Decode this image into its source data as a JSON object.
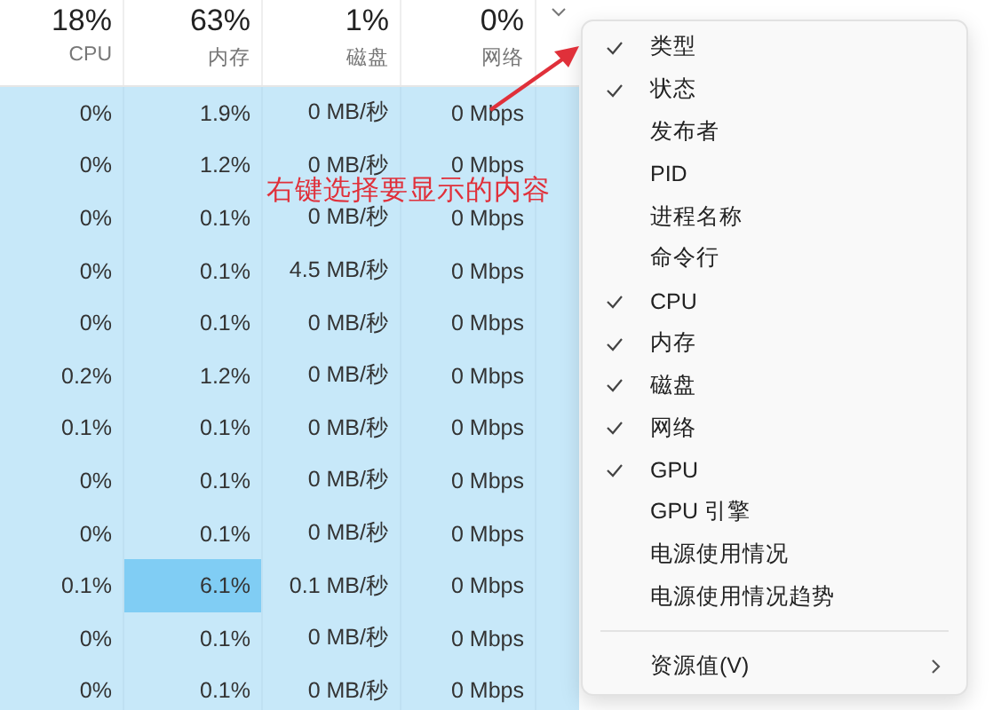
{
  "header": [
    {
      "value": "18%",
      "label": "CPU"
    },
    {
      "value": "63%",
      "label": "内存"
    },
    {
      "value": "1%",
      "label": "磁盘"
    },
    {
      "value": "0%",
      "label": "网络"
    }
  ],
  "rows": [
    {
      "cells": [
        "0%",
        "1.9%",
        "0 MB/秒",
        "0 Mbps"
      ],
      "memory_high": false
    },
    {
      "cells": [
        "0%",
        "1.2%",
        "0 MB/秒",
        "0 Mbps"
      ],
      "memory_high": false
    },
    {
      "cells": [
        "0%",
        "0.1%",
        "0 MB/秒",
        "0 Mbps"
      ],
      "memory_high": false
    },
    {
      "cells": [
        "0%",
        "0.1%",
        "4.5 MB/秒",
        "0 Mbps"
      ],
      "memory_high": false
    },
    {
      "cells": [
        "0%",
        "0.1%",
        "0 MB/秒",
        "0 Mbps"
      ],
      "memory_high": false
    },
    {
      "cells": [
        "0.2%",
        "1.2%",
        "0 MB/秒",
        "0 Mbps"
      ],
      "memory_high": false
    },
    {
      "cells": [
        "0.1%",
        "0.1%",
        "0 MB/秒",
        "0 Mbps"
      ],
      "memory_high": false
    },
    {
      "cells": [
        "0%",
        "0.1%",
        "0 MB/秒",
        "0 Mbps"
      ],
      "memory_high": false
    },
    {
      "cells": [
        "0%",
        "0.1%",
        "0 MB/秒",
        "0 Mbps"
      ],
      "memory_high": false
    },
    {
      "cells": [
        "0.1%",
        "6.1%",
        "0.1 MB/秒",
        "0 Mbps"
      ],
      "memory_high": true
    },
    {
      "cells": [
        "0%",
        "0.1%",
        "0 MB/秒",
        "0 Mbps"
      ],
      "memory_high": false
    },
    {
      "cells": [
        "0%",
        "0.1%",
        "0 MB/秒",
        "0 Mbps"
      ],
      "memory_high": false
    }
  ],
  "context_menu": [
    {
      "kind": "item",
      "label": "类型",
      "checked": true
    },
    {
      "kind": "item",
      "label": "状态",
      "checked": true
    },
    {
      "kind": "item",
      "label": "发布者",
      "checked": false
    },
    {
      "kind": "item",
      "label": "PID",
      "checked": false
    },
    {
      "kind": "item",
      "label": "进程名称",
      "checked": false
    },
    {
      "kind": "item",
      "label": "命令行",
      "checked": false
    },
    {
      "kind": "item",
      "label": "CPU",
      "checked": true
    },
    {
      "kind": "item",
      "label": "内存",
      "checked": true
    },
    {
      "kind": "item",
      "label": "磁盘",
      "checked": true
    },
    {
      "kind": "item",
      "label": "网络",
      "checked": true
    },
    {
      "kind": "item",
      "label": "GPU",
      "checked": true
    },
    {
      "kind": "item",
      "label": "GPU 引擎",
      "checked": false
    },
    {
      "kind": "item",
      "label": "电源使用情况",
      "checked": false
    },
    {
      "kind": "item",
      "label": "电源使用情况趋势",
      "checked": false
    },
    {
      "kind": "separator"
    },
    {
      "kind": "submenu",
      "label": "资源值(V)"
    }
  ],
  "annotation": "右键选择要显示的内容"
}
